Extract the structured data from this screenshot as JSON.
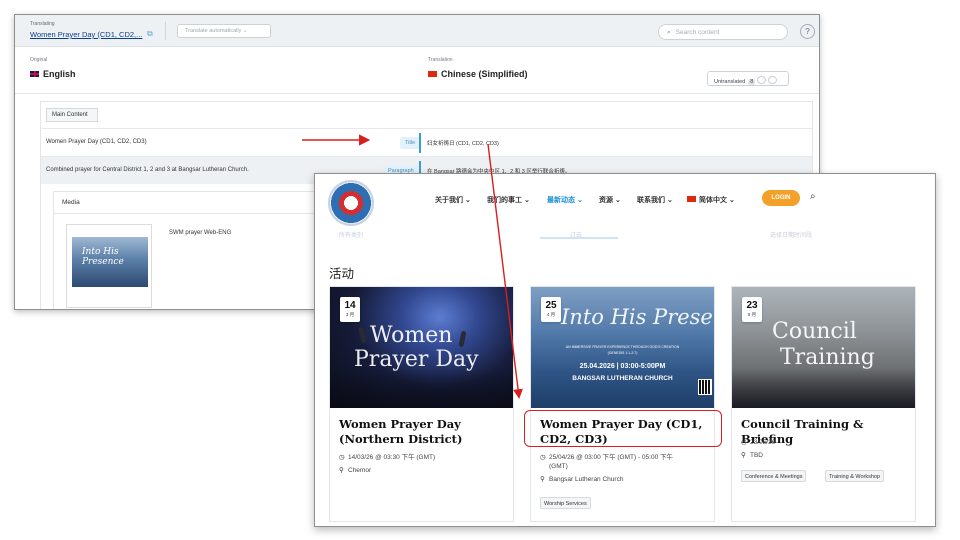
{
  "editor": {
    "translating_label": "Translating",
    "document_name": "Women Prayer Day (CD1, CD2,...",
    "external_icon": "external-link-icon",
    "translate_auto": "Translate automatically",
    "search_placeholder": "Search content",
    "help_icon": "help-icon",
    "original_label": "Original",
    "original_lang": "English",
    "translation_label": "Translation",
    "translation_lang": "Chinese (Simplified)",
    "untranslated_label": "Untranslated",
    "untranslated_count": "8",
    "main_content": "Main Content",
    "rows": [
      {
        "source": "Women Prayer Day (CD1, CD2, CD3)",
        "tag": "Title",
        "target": "妇女祈祷日 (CD1, CD2, CD3)"
      },
      {
        "source": "Combined prayer for Central District 1, 2 and 3 at Bangsar Lutheran Church.",
        "tag": "Paragraph",
        "target": "在 Bangsar 路德会为中央中区 1、2 和 3 区举行联合祈祷。"
      }
    ],
    "media_label": "Media",
    "media_file": "SWM prayer Web-ENG",
    "thumb_text": "Into His Presence"
  },
  "site": {
    "nav": [
      {
        "label": "关于我们 ⌄"
      },
      {
        "label": "我们的事工 ⌄"
      },
      {
        "label": "最新动态 ⌄"
      },
      {
        "label": "资源 ⌄"
      },
      {
        "label": "联系我们 ⌄"
      },
      {
        "label": "简体中文 ⌄"
      }
    ],
    "login": "LOGIN",
    "section_title": "活动",
    "ghost_left": "所有类别",
    "ghost_mid": "过去",
    "ghost_right": "选择日期时间段",
    "cards": [
      {
        "day": "14",
        "month": "3 月",
        "image_text": "Women Prayer Day",
        "title": "Women Prayer Day (Northern District)",
        "datetime": "14/03/26 @ 03:30 下午 (GMT)",
        "location": "Chemor",
        "tags": []
      },
      {
        "day": "25",
        "month": "4 月",
        "image_text": "Into His Presence",
        "image_sub": "AN IMMERSIVE PRAYER EXPERIENCE THROUGH GOD'S CREATION",
        "image_sub2": "(GENESIS 1:1-2:7)",
        "image_date": "25.04.2026 | 03:00-5:00PM",
        "image_venue": "BANGSAR LUTHERAN CHURCH",
        "title": "Women Prayer Day (CD1, CD2, CD3)",
        "datetime": "25/04/26 @ 03:00 下午 (GMT) - 05:00 下午",
        "datetime2": "(GMT)",
        "location": "Bangsar Lutheran Church",
        "tags": [
          "Worship Services"
        ]
      },
      {
        "day": "23",
        "month": "5 月",
        "image_text": "Council Training",
        "title": "Council Training & Briefing",
        "datetime": "23/05/26",
        "location": "TBD",
        "tags": [
          "Conference & Meetings",
          "Training & Workshop"
        ]
      }
    ]
  },
  "colors": {
    "accent_blue": "#3d9ad8",
    "login_orange": "#f4a12a",
    "annotation_red": "#d81f1f"
  }
}
